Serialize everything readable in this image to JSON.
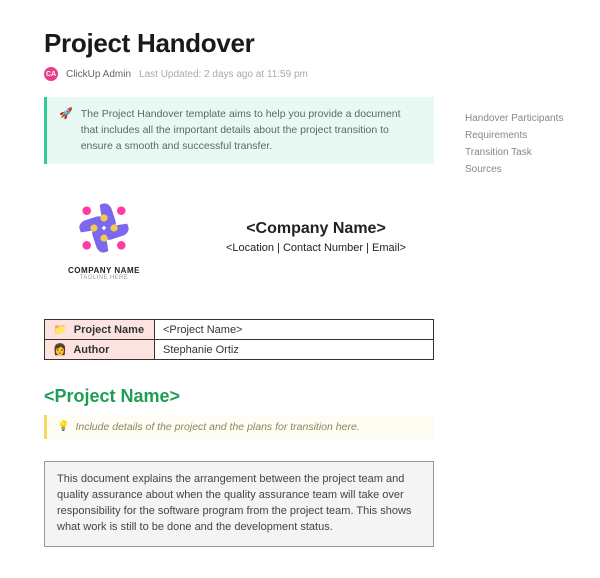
{
  "header": {
    "title": "Project Handover",
    "avatar_initials": "CA",
    "author": "ClickUp Admin",
    "last_updated": "Last Updated: 2 days ago at 11:59 pm"
  },
  "callout": {
    "emoji": "🚀",
    "text": "The Project Handover template aims to help you provide a document that includes all the important details about the project transition to ensure a smooth and successful transfer."
  },
  "sidebar": {
    "items": [
      "Handover Participants",
      "Requirements",
      "Transition Task",
      "Sources"
    ]
  },
  "company": {
    "logo_text": "COMPANY NAME",
    "logo_tagline": "TAGLINE HERE",
    "name_placeholder": "<Company Name>",
    "contact_placeholder": "<Location | Contact Number | Email>"
  },
  "info_table": {
    "rows": [
      {
        "emoji": "📁",
        "label": "Project Name",
        "value": "<Project Name>"
      },
      {
        "emoji": "👩",
        "label": "Author",
        "value": "Stephanie Ortiz"
      }
    ]
  },
  "section": {
    "heading": "<Project Name>",
    "hint_emoji": "💡",
    "hint_text": "Include details of the project and the plans for transition here."
  },
  "description": {
    "text": "This document explains the arrangement between the project team and quality assurance about when the quality assurance team will take over responsibility for the software program from the project team. This shows what work is still to be done and the development status."
  }
}
